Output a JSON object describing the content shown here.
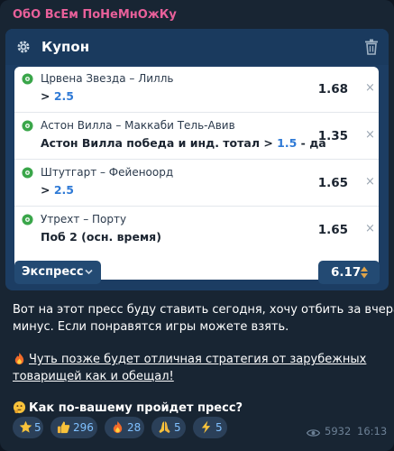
{
  "channel": {
    "name": "ОбО ВсЕм ПоНеМнОжКу"
  },
  "coupon": {
    "title": "Купон",
    "bets": [
      {
        "teams": "Црвена Звезда – Лилль",
        "pick_prefix": "> ",
        "pick_value": "2.5",
        "pick_suffix": "",
        "odds": "1.68"
      },
      {
        "teams": "Астон Вилла – Маккаби Тель-Авив",
        "pick_prefix": "Астон Вилла победа и инд. тотал > ",
        "pick_value": "1.5",
        "pick_suffix": " - да",
        "odds": "1.35"
      },
      {
        "teams": "Штутгарт – Фейеноорд",
        "pick_prefix": "> ",
        "pick_value": "2.5",
        "pick_suffix": "",
        "odds": "1.65"
      },
      {
        "teams": "Утрехт – Порту",
        "pick_prefix": "Поб 2 (осн. время)",
        "pick_value": "",
        "pick_suffix": "",
        "odds": "1.65"
      }
    ],
    "mode": "Экспресс",
    "total_odds": "6.17",
    "close_glyph": "×"
  },
  "message": {
    "line1": "Вот на этот пресс буду ставить сегодня, хочу отбить за вчера",
    "line2": "минус. Если понравятся игры можете взять.",
    "line3": "Чуть позже будет отличная стратегия от зарубежных",
    "line4": "товарищей как и обещал!",
    "line5": "Как по-вашему пройдет пресс?"
  },
  "reactions": [
    {
      "icon": "star-icon",
      "count": "5"
    },
    {
      "icon": "thumbs-up-icon",
      "count": "296"
    },
    {
      "icon": "fire-icon",
      "count": "28"
    },
    {
      "icon": "praying-hands-icon",
      "count": "5"
    },
    {
      "icon": "lightning-icon",
      "count": "5"
    }
  ],
  "meta": {
    "views": "5932",
    "time": "16:13"
  },
  "colors": {
    "accent_name": "#e8609a",
    "link": "#7fc0ff",
    "odds_value": "#2f7ad6",
    "background": "#182533"
  }
}
